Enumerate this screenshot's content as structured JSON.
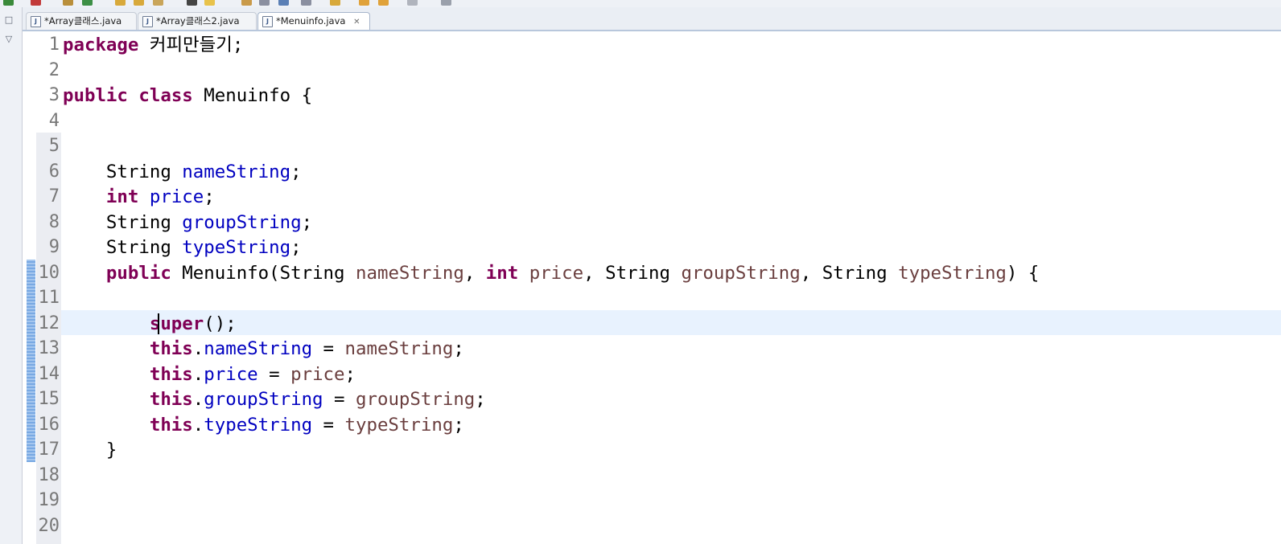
{
  "tabs": [
    {
      "label": "*Array클래스.java",
      "icon": "java-file-icon",
      "active": false
    },
    {
      "label": "*Array클래스2.java",
      "icon": "java-file-icon",
      "active": false
    },
    {
      "label": "*Menuinfo.java",
      "icon": "java-file-icon",
      "active": true,
      "close": "✕"
    }
  ],
  "editor": {
    "line_numbers": [
      "1",
      "2",
      "3",
      "4",
      "5",
      "6",
      "7",
      "8",
      "9",
      "10",
      "11",
      "12",
      "13",
      "14",
      "15",
      "16",
      "17",
      "18",
      "19",
      "20"
    ],
    "current_line": 12,
    "tokens": {
      "package_kw": "package",
      "package_name": "커피만들기;",
      "public_kw": "public",
      "class_kw": "class",
      "class_name": "Menuinfo {",
      "string_type": "String",
      "int_kw": "int",
      "f_name": "nameString",
      "f_price": "price",
      "f_group": "groupString",
      "f_type": "typeString",
      "semi": ";",
      "ctor_name": "Menuinfo(",
      "comma": ", ",
      "ctor_end": ") {",
      "super_kw": "super",
      "super_end": "();",
      "this_kw": "this",
      "dot": ".",
      "assign": " = ",
      "close_brace": "}"
    }
  },
  "colors": {
    "keyword": "#7f0055",
    "field": "#0000c0",
    "parameter": "#6a3e3e",
    "current_line": "#e8f2fe",
    "change_bar": "#79a9e3"
  }
}
